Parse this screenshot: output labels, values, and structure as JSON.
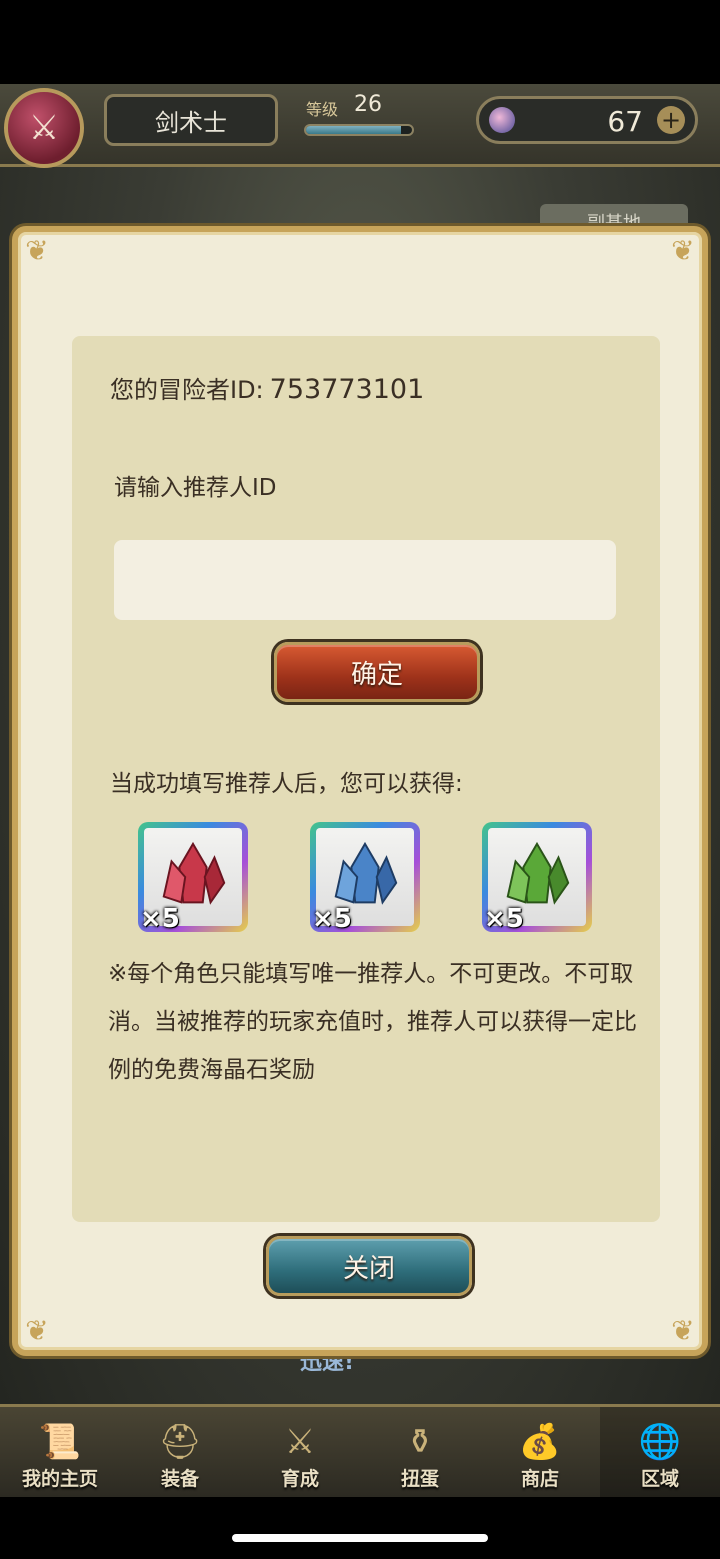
{
  "header": {
    "class_name": "剑术士",
    "level_label": "等级",
    "level": "26",
    "level_progress": 0.9,
    "currency": "67"
  },
  "background": {
    "tab_text": "副基地",
    "banner_text": "迅速!"
  },
  "modal": {
    "id_label": "您的冒险者ID:",
    "id_value": "753773101",
    "referrer_label": "请输入推荐人ID",
    "referrer_value": "",
    "confirm_label": "确定",
    "reward_intro": "当成功填写推荐人后，您可以获得:",
    "rewards": [
      {
        "item": "red-crystal-icon",
        "color": "#c8384a",
        "qty": "×5"
      },
      {
        "item": "blue-crystal-icon",
        "color": "#4a84c8",
        "qty": "×5"
      },
      {
        "item": "green-crystal-icon",
        "color": "#5aa838",
        "qty": "×5"
      }
    ],
    "note": "※每个角色只能填写唯一推荐人。不可更改。不可取消。当被推荐的玩家充值时，推荐人可以获得一定比例的免费海晶石奖励",
    "close_label": "关闭"
  },
  "nav": {
    "items": [
      {
        "label": "我的主页",
        "icon": "scroll-icon"
      },
      {
        "label": "装备",
        "icon": "helmet-icon"
      },
      {
        "label": "育成",
        "icon": "sword-icon"
      },
      {
        "label": "扭蛋",
        "icon": "gacha-icon"
      },
      {
        "label": "商店",
        "icon": "shop-icon"
      },
      {
        "label": "区域",
        "icon": "globe-icon"
      }
    ]
  }
}
